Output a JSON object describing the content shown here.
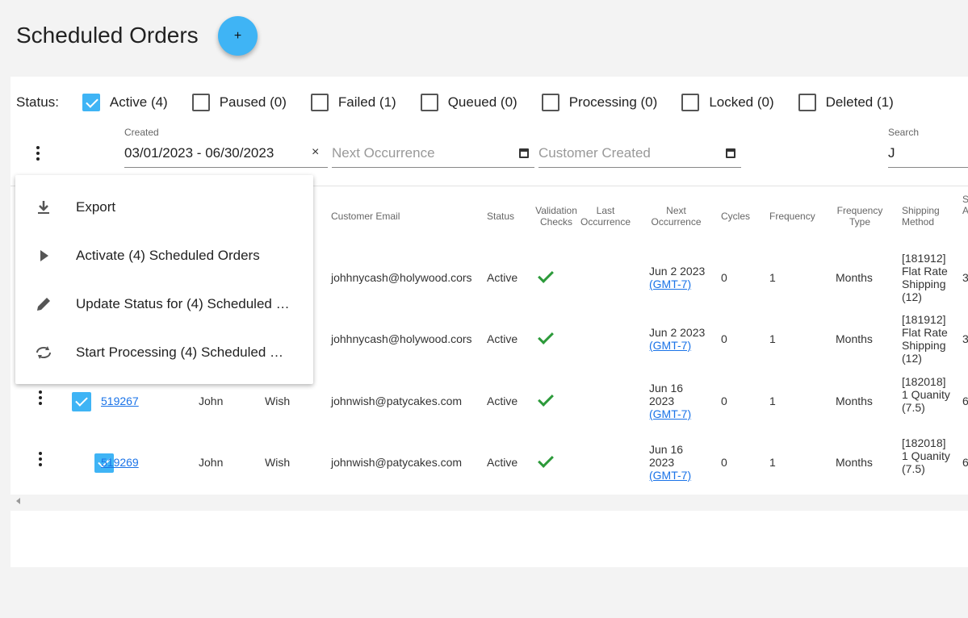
{
  "page": {
    "title": "Scheduled Orders",
    "add_symbol": "+"
  },
  "status_filter": {
    "label": "Status:",
    "items": [
      {
        "label": "Active (4)",
        "checked": true
      },
      {
        "label": "Paused (0)",
        "checked": false
      },
      {
        "label": "Failed (1)",
        "checked": false
      },
      {
        "label": "Queued (0)",
        "checked": false
      },
      {
        "label": "Processing (0)",
        "checked": false
      },
      {
        "label": "Locked (0)",
        "checked": false
      },
      {
        "label": "Deleted (1)",
        "checked": false
      }
    ]
  },
  "filters": {
    "created_label": "Created",
    "created_value": "03/01/2023 - 06/30/2023",
    "clear_symbol": "×",
    "next_occurrence_placeholder": "Next Occurrence",
    "customer_created_placeholder": "Customer Created",
    "search_label": "Search",
    "search_value": "J"
  },
  "table": {
    "headers": {
      "customer_email": "Customer Email",
      "status": "Status",
      "validation_checks": "Validation Checks",
      "last_occurrence": "Last Occurrence",
      "next_occurrence": "Next Occurrence",
      "cycles": "Cycles",
      "frequency": "Frequency",
      "frequency_type": "Frequency Type",
      "shipping_method": "Shipping Method",
      "partial": "S A"
    },
    "rows": [
      {
        "id": "",
        "first": "",
        "last": "",
        "email": "johhnycash@holywood.cors",
        "status": "Active",
        "next_date": "Jun 2 2023",
        "tz": "(GMT-7)",
        "cycles": "0",
        "frequency": "1",
        "frequency_type": "Months",
        "shipping": "[181912] Flat Rate Shipping (12)",
        "partial": "3"
      },
      {
        "id": "",
        "first": "",
        "last": "",
        "email": "johhnycash@holywood.cors",
        "status": "Active",
        "next_date": "Jun 2 2023",
        "tz": "(GMT-7)",
        "cycles": "0",
        "frequency": "1",
        "frequency_type": "Months",
        "shipping": "[181912] Flat Rate Shipping (12)",
        "partial": "3"
      },
      {
        "id": "519267",
        "first": "John",
        "last": "Wish",
        "email": "johnwish@patycakes.com",
        "status": "Active",
        "next_date": "Jun 16 2023",
        "tz": "(GMT-7)",
        "cycles": "0",
        "frequency": "1",
        "frequency_type": "Months",
        "shipping": "[182018] 1 Quanity (7.5)",
        "partial": "6"
      },
      {
        "id": "519269",
        "first": "John",
        "last": "Wish",
        "email": "johnwish@patycakes.com",
        "status": "Active",
        "next_date": "Jun 16 2023",
        "tz": "(GMT-7)",
        "cycles": "0",
        "frequency": "1",
        "frequency_type": "Months",
        "shipping": "[182018] 1 Quanity (7.5)",
        "partial": "6"
      }
    ]
  },
  "menu": {
    "items": [
      {
        "label": "Export",
        "icon": "download-icon"
      },
      {
        "label": "Activate (4) Scheduled Orders",
        "icon": "play-icon"
      },
      {
        "label": "Update Status for (4) Scheduled …",
        "icon": "pencil-icon"
      },
      {
        "label": "Start Processing (4) Scheduled …",
        "icon": "sync-icon"
      }
    ]
  },
  "colors": {
    "accent": "#3fb4f5",
    "link": "#1a73e8",
    "check": "#2c9a3a"
  }
}
